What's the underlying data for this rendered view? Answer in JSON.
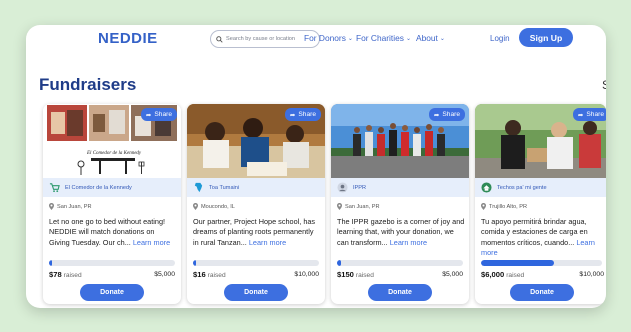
{
  "header": {
    "brand": "NEDDIE",
    "search_placeholder": "Search by cause or location",
    "nav": [
      {
        "label": "For Donors"
      },
      {
        "label": "For Charities"
      },
      {
        "label": "About"
      }
    ],
    "login_label": "Login",
    "signup_label": "Sign Up"
  },
  "page": {
    "title": "Fundraisers",
    "scroll_glyph": "S"
  },
  "cards": [
    {
      "share_label": "Share",
      "org_name": "El Comedor de la Kennedy",
      "location": "San Juan, PR",
      "description": "Let no one go to bed without eating! NEDDIE will match donations on Giving Tuesday. Our ch... ",
      "more_label": "Learn more",
      "raised": "$78",
      "raised_label": "raised",
      "goal": "$5,000",
      "progress": 0.016,
      "donate_label": "Donate",
      "image_caption": "El Comedor de la Kennedy"
    },
    {
      "share_label": "Share",
      "org_name": "Toa Tumaini",
      "location": "Moucondo, IL",
      "description": "Our partner, Project Hope school, has dreams of planting roots permanently in rural Tanzan... ",
      "more_label": "Learn more",
      "raised": "$16",
      "raised_label": "raised",
      "goal": "$10,000",
      "progress": 0.002,
      "donate_label": "Donate"
    },
    {
      "share_label": "Share",
      "org_name": "IPPR",
      "location": "San Juan, PR",
      "description": "The IPPR gazebo is a corner of joy and learning that, with your donation, we can transform... ",
      "more_label": "Learn more",
      "raised": "$150",
      "raised_label": "raised",
      "goal": "$5,000",
      "progress": 0.03,
      "donate_label": "Donate"
    },
    {
      "share_label": "Share",
      "org_name": "Techos pa' mi gente",
      "location": "Trujillo Alto, PR",
      "description": "Tu apoyo permitirá brindar agua, comida y estaciones de carga en momentos críticos, cuando... ",
      "more_label": "Learn more",
      "raised": "$6,000",
      "raised_label": "raised",
      "goal": "$10,000",
      "progress": 0.6,
      "donate_label": "Donate"
    }
  ],
  "colors": {
    "accent": "#3d6fe0",
    "brand": "#3461c7",
    "title": "#1f3c88",
    "background": "#d9eed6",
    "org_strip": "#e6eefb"
  }
}
